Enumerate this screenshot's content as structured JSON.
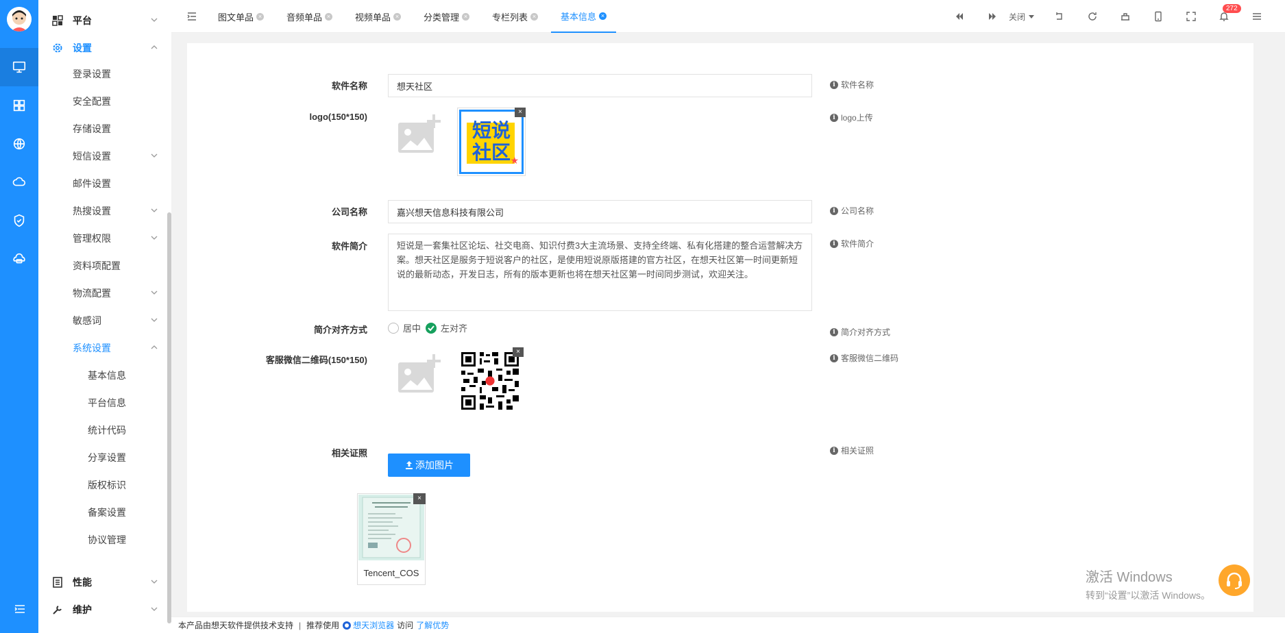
{
  "sidebar": {
    "platform": "平台",
    "settings": "设置",
    "items": [
      "登录设置",
      "安全配置",
      "存储设置",
      "短信设置",
      "邮件设置",
      "热搜设置",
      "管理权限",
      "资料项配置",
      "物流配置",
      "敏感词",
      "系统设置"
    ],
    "system_sub": [
      "基本信息",
      "平台信息",
      "统计代码",
      "分享设置",
      "版权标识",
      "备案设置",
      "协议管理"
    ],
    "performance": "性能",
    "maintenance": "维护"
  },
  "tabs": [
    {
      "label": "图文单品"
    },
    {
      "label": "音频单品"
    },
    {
      "label": "视频单品"
    },
    {
      "label": "分类管理"
    },
    {
      "label": "专栏列表"
    },
    {
      "label": "基本信息"
    }
  ],
  "header": {
    "close_label": "关闭",
    "notification_count": "272"
  },
  "form": {
    "software_name_label": "软件名称",
    "software_name_value": "想天社区",
    "software_name_hint": "软件名称",
    "logo_label": "logo(150*150)",
    "logo_hint": "logo上传",
    "logo_text_line1": "短说",
    "logo_text_line2": "社区",
    "company_label": "公司名称",
    "company_value": "嘉兴想天信息科技有限公司",
    "company_hint": "公司名称",
    "intro_label": "软件简介",
    "intro_value": "短说是一套集社区论坛、社交电商、知识付费3大主流场景、支持全终端、私有化搭建的整合运营解决方案。想天社区是服务于短说客户的社区，是使用短说原版搭建的官方社区，在想天社区第一时间更新短说的最新动态，开发日志，所有的版本更新也将在想天社区第一时间同步测试，欢迎关注。",
    "intro_hint": "软件简介",
    "align_label": "简介对齐方式",
    "align_option_center": "居中",
    "align_option_left": "左对齐",
    "align_hint": "简介对齐方式",
    "qrcode_label": "客服微信二维码(150*150)",
    "qrcode_hint": "客服微信二维码",
    "cert_label": "相关证照",
    "cert_hint": "相关证照",
    "add_image_button": "添加图片",
    "cert_file_name": "Tencent_COS"
  },
  "footer": {
    "text": "本产品由想天软件提供技术支持",
    "separator": "|",
    "recommend": "推荐使用",
    "browser_link": "想天浏览器",
    "visit": "访问",
    "learn_link": "了解优势"
  },
  "watermark": {
    "line1": "激活 Windows",
    "line2": "转到“设置”以激活 Windows。"
  },
  "colors": {
    "primary": "#1e90ff",
    "radio_checked": "#16a05d",
    "badge": "#ff4d4f",
    "support_button": "#ffa72b"
  }
}
